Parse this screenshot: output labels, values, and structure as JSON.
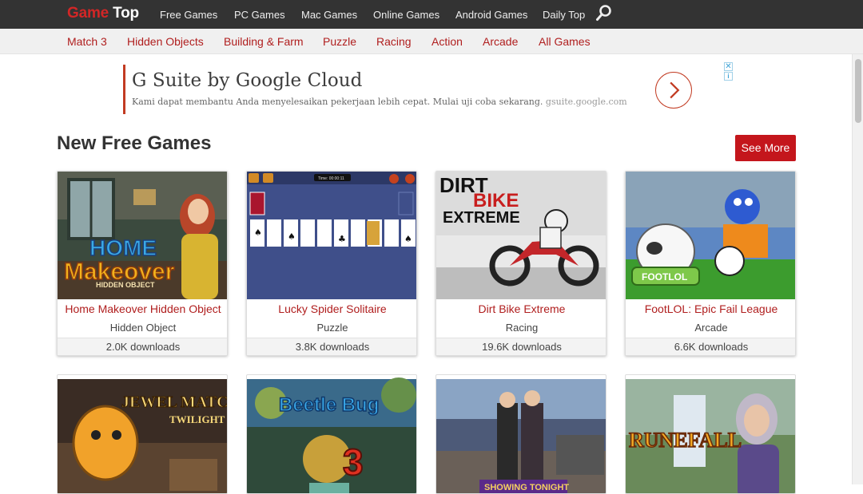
{
  "header": {
    "logo": {
      "part1": "Game",
      "part2": "Top"
    },
    "nav": [
      "Free Games",
      "PC Games",
      "Mac Games",
      "Online Games",
      "Android Games",
      "Daily Top"
    ],
    "search_icon": "search-icon"
  },
  "categories": [
    "Match 3",
    "Hidden Objects",
    "Building & Farm",
    "Puzzle",
    "Racing",
    "Action",
    "Arcade",
    "All Games"
  ],
  "ad": {
    "title": "G Suite by Google Cloud",
    "desc": "Kami dapat membantu Anda menyelesaikan pekerjaan lebih cepat. Mulai uji coba sekarang.",
    "url": "gsuite.google.com",
    "close": "✕",
    "info": "i"
  },
  "section": {
    "title": "New Free Games",
    "see_more": "See More"
  },
  "games": [
    {
      "title": "Home Makeover Hidden Object",
      "category": "Hidden Object",
      "downloads": "2.0K downloads",
      "art_lines": [
        "HOME",
        "Makeover",
        "HIDDEN OBJECT"
      ]
    },
    {
      "title": "Lucky Spider Solitaire",
      "category": "Puzzle",
      "downloads": "3.8K downloads",
      "art_lines": [
        "Time: 00:00:11"
      ]
    },
    {
      "title": "Dirt Bike Extreme",
      "category": "Racing",
      "downloads": "19.6K downloads",
      "art_lines": [
        "DIRT",
        "BIKE",
        "EXTREME"
      ]
    },
    {
      "title": "FootLOL: Epic Fail League",
      "category": "Arcade",
      "downloads": "6.6K downloads",
      "art_lines": [
        "FOOTLOL"
      ]
    }
  ],
  "games_row2": [
    {
      "art_lines": [
        "JEWEL MATCH",
        "TWILIGHT"
      ]
    },
    {
      "art_lines": [
        "Beetle Bug",
        "3"
      ]
    },
    {
      "art_lines": [
        "SHOWING TONIGHT"
      ]
    },
    {
      "art_lines": [
        "RUNEFALL"
      ]
    }
  ],
  "colors": {
    "accent": "#b01e1e",
    "button": "#c4161c",
    "topbar": "#333333"
  }
}
